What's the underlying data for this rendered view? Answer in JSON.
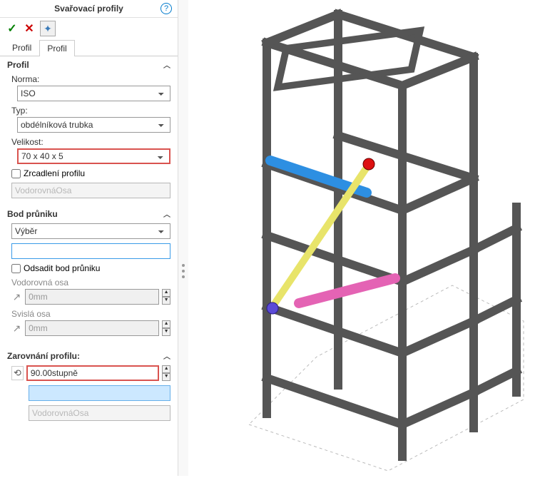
{
  "header": {
    "title": "Svařovací profily"
  },
  "tabs": {
    "items": [
      "Profil",
      "Profil"
    ],
    "active_index": 1
  },
  "sections": {
    "profil": {
      "title": "Profil",
      "norma_label": "Norma:",
      "norma_value": "ISO",
      "typ_label": "Typ:",
      "typ_value": "obdélníková trubka",
      "velikost_label": "Velikost:",
      "velikost_value": "70 x 40 x 5",
      "mirror_label": "Zrcadlení profilu",
      "mirror_axis": "VodorovnáOsa"
    },
    "bod_pruniku": {
      "title": "Bod průniku",
      "vyber_value": "Výběr",
      "blank_value": "",
      "offset_label": "Odsadit bod průniku",
      "h_axis_label": "Vodorovná osa",
      "h_axis_value": "0mm",
      "v_axis_label": "Svislá osa",
      "v_axis_value": "0mm"
    },
    "zarovnani": {
      "title": "Zarovnání profilu:",
      "angle_value": "90.00stupně",
      "blank_value": "",
      "axis_value": "VodorovnáOsa"
    }
  },
  "icons": {
    "help": "?",
    "ok": "✓",
    "cancel": "✕",
    "pin": "✦",
    "chev_up": "︿",
    "arrow_ne": "↗",
    "rotate": "⟲"
  }
}
